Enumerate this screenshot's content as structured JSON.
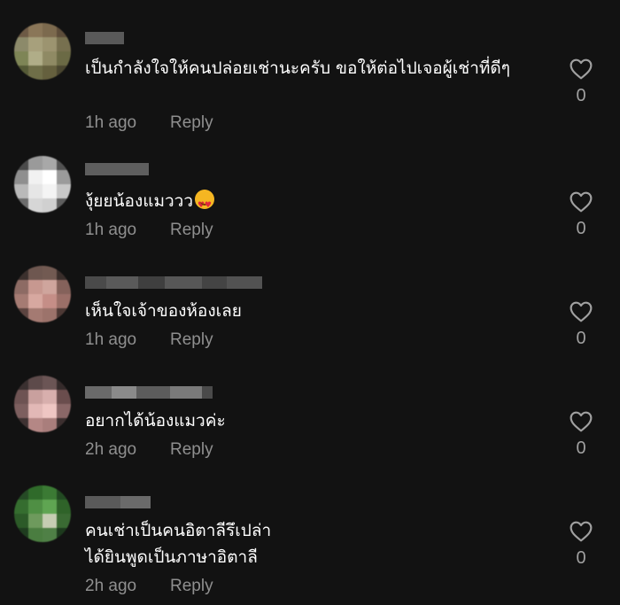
{
  "comments": [
    {
      "text": "เป็นกำลังใจให้คนปล่อยเช่านะครับ ขอให้ต่อไปเจอผู้เช่าที่ดีๆ",
      "time": "1h ago",
      "reply_label": "Reply",
      "likes": "0"
    },
    {
      "text": "งุ้ยยน้องแมววว",
      "emoji": "smiling-face-with-hearts-emoji",
      "time": "1h ago",
      "reply_label": "Reply",
      "likes": "0"
    },
    {
      "text": "เห็นใจเจ้าของห้องเลย",
      "time": "1h ago",
      "reply_label": "Reply",
      "likes": "0"
    },
    {
      "text": "อยากได้น้องแมวค่ะ",
      "time": "2h ago",
      "reply_label": "Reply",
      "likes": "0"
    },
    {
      "text": "คนเช่าเป็นคนอิตาลีรึเปล่า ได้ยินพูดเป็นภาษาอิตาลี",
      "time": "2h ago",
      "reply_label": "Reply",
      "likes": "0"
    }
  ],
  "icons": {
    "like": "heart-outline-icon"
  },
  "colors": {
    "background": "#121212",
    "text": "#ffffff",
    "meta": "#8f8f8f",
    "like_count": "#a0a0a0"
  }
}
